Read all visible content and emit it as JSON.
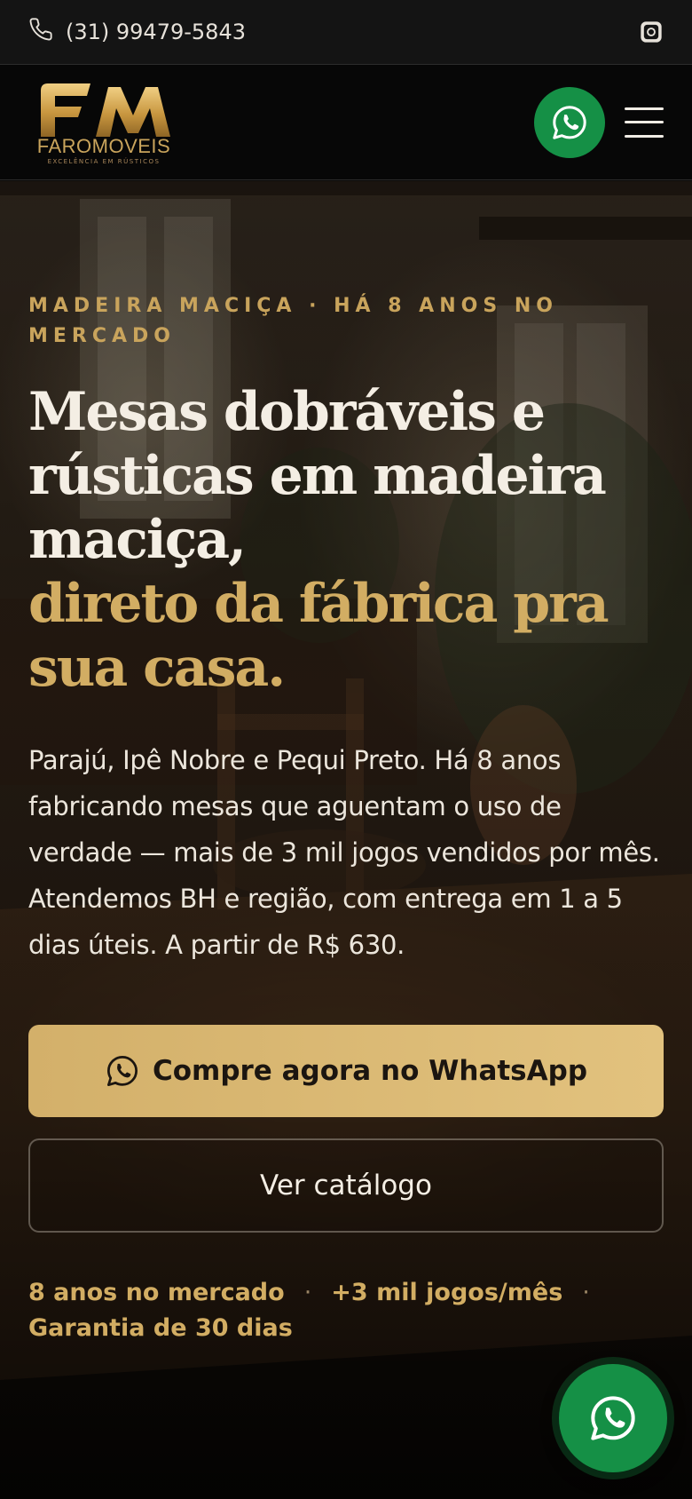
{
  "topbar": {
    "phone_icon": "phone-icon",
    "phone": "(31) 99479-5843",
    "social_icon": "instagram-icon"
  },
  "header": {
    "logo_brand": "FAROMOVEIS",
    "logo_tagline": "EXCELÊNCIA EM RÚSTICOS",
    "whatsapp_icon": "whatsapp-icon",
    "menu_icon": "hamburger-menu-icon"
  },
  "hero": {
    "eyebrow": "MADEIRA MACIÇA · HÁ 8 ANOS NO MERCADO",
    "headline": "Mesas dobráveis e rústicas em madeira maciça,",
    "headline_accent": "direto da fábrica pra sua casa.",
    "lead": "Parajú, Ipê Nobre e Pequi Preto. Há 8 anos fabricando mesas que aguentam o uso de verdade — mais de 3 mil jogos vendidos por mês. Atendemos BH e região, com entrega em 1 a 5 dias úteis. A partir de R$ 630.",
    "cta_primary": "Compre agora no WhatsApp",
    "cta_secondary": "Ver catálogo",
    "stats": [
      "8 anos no mercado",
      "+3 mil jogos/mês",
      "Garantia de 30 dias"
    ],
    "stats_separator": "·"
  },
  "colors": {
    "accent_gold": "#d2ad63",
    "whatsapp_green": "#159046",
    "background": "#0b0a09"
  }
}
